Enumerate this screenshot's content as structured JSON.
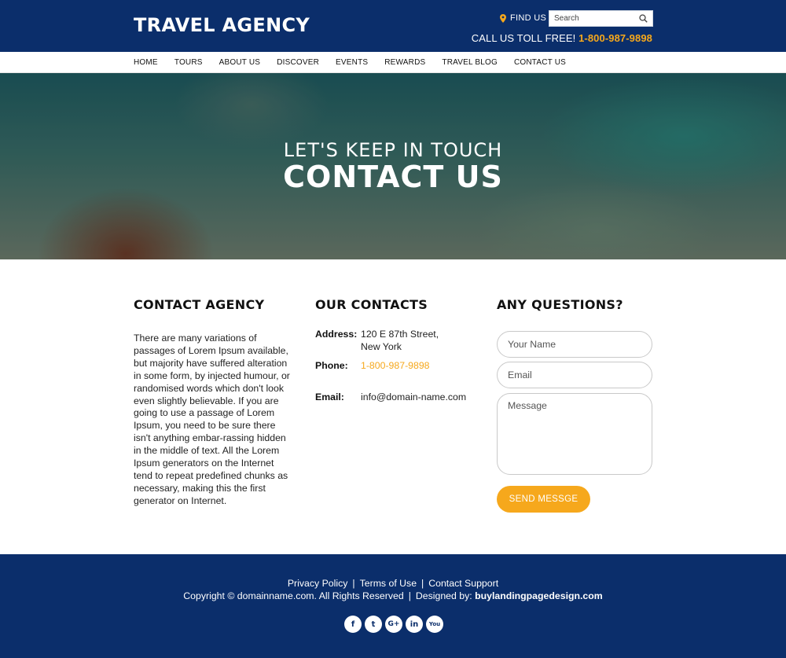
{
  "brand": {
    "logo": "TRAVEL AGENCY"
  },
  "header": {
    "find_us": "FIND US",
    "search_placeholder": "Search",
    "toll_free_label": "CALL US TOLL FREE!",
    "toll_free_number": "1-800-987-9898"
  },
  "nav": {
    "items": [
      "HOME",
      "TOURS",
      "ABOUT US",
      "DISCOVER",
      "EVENTS",
      "REWARDS",
      "TRAVEL BLOG",
      "CONTACT US"
    ]
  },
  "hero": {
    "subtitle": "LET'S KEEP IN TOUCH",
    "title": "CONTACT US"
  },
  "agency": {
    "heading": "CONTACT AGENCY",
    "body": "There are many variations of passages of Lorem Ipsum available, but majority have suffered alteration in some form, by injected humour, or randomised words which don't look even slightly believable. If you are going to use a passage of Lorem Ipsum, you need to be sure there isn't anything embar-rassing hidden in the middle of text. All the Lorem Ipsum generators on the Internet tend to repeat predefined chunks as necessary, making this the first generator on Internet."
  },
  "contacts": {
    "heading": "OUR CONTACTS",
    "address_label": "Address:",
    "address_line1": "120 E 87th Street,",
    "address_line2": "New York",
    "phone_label": "Phone:",
    "phone": "1-800-987-9898",
    "email_label": "Email:",
    "email": "info@domain-name.com"
  },
  "form": {
    "heading": "ANY QUESTIONS?",
    "name_placeholder": "Your Name",
    "email_placeholder": "Email",
    "message_placeholder": "Message",
    "submit": "SEND MESSGE"
  },
  "footer": {
    "links": [
      "Privacy Policy",
      "Terms of Use",
      "Contact Support"
    ],
    "separator": "|",
    "copyright": "Copyright © domainname.com. All Rights Reserved",
    "designed_by_label": "Designed by:",
    "designed_by": "buylandingpagedesign.com"
  },
  "social": [
    {
      "icon": "facebook-icon",
      "glyph": "f"
    },
    {
      "icon": "twitter-icon",
      "glyph": "t"
    },
    {
      "icon": "google-plus-icon",
      "glyph": "G+"
    },
    {
      "icon": "linkedin-icon",
      "glyph": "in"
    },
    {
      "icon": "youtube-icon",
      "glyph": "You"
    }
  ],
  "colors": {
    "navy": "#0b2e6b",
    "accent": "#f6a81c"
  }
}
